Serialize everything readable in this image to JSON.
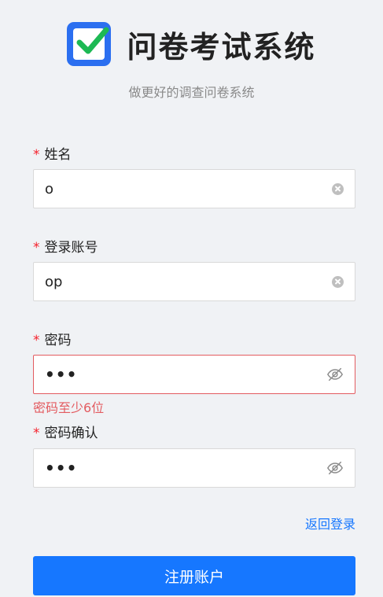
{
  "header": {
    "title": "问卷考试系统",
    "subtitle": "做更好的调查问卷系统",
    "logo_icon": "checkbox-logo-icon"
  },
  "form": {
    "required_mark": "*",
    "name": {
      "label": "姓名",
      "value": "o"
    },
    "account": {
      "label": "登录账号",
      "value": "op"
    },
    "password": {
      "label": "密码",
      "masked_value": "•••",
      "error": "密码至少6位"
    },
    "confirm_password": {
      "label": "密码确认",
      "masked_value": "•••"
    }
  },
  "actions": {
    "back_to_login": "返回登录",
    "register": "注册账户"
  },
  "colors": {
    "background": "#f0f2f5",
    "primary": "#1677ff",
    "error": "#e35b60",
    "logo_blue": "#2b6ff0",
    "logo_check": "#1db954"
  }
}
